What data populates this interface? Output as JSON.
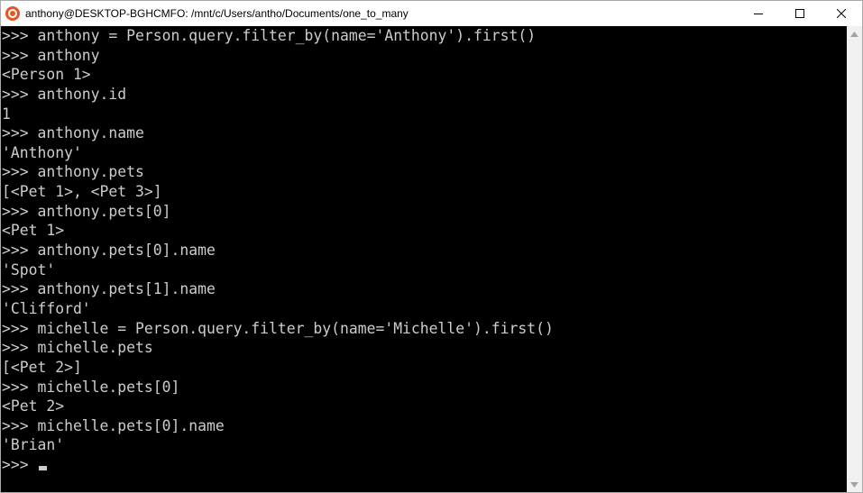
{
  "window": {
    "title": "anthony@DESKTOP-BGHCMFO: /mnt/c/Users/antho/Documents/one_to_many"
  },
  "colors": {
    "background": "#000000",
    "text": "#cccccc",
    "icon_accent": "#e95420"
  },
  "icons": {
    "app": "ubuntu-icon",
    "minimize": "minimize-icon",
    "maximize": "maximize-icon",
    "close": "close-icon",
    "scroll_up": "scroll-up-arrow-icon",
    "scroll_down": "scroll-down-arrow-icon"
  },
  "console": {
    "lines": [
      ">>> anthony = Person.query.filter_by(name='Anthony').first()",
      ">>> anthony",
      "<Person 1>",
      ">>> anthony.id",
      "1",
      ">>> anthony.name",
      "'Anthony'",
      ">>> anthony.pets",
      "[<Pet 1>, <Pet 3>]",
      ">>> anthony.pets[0]",
      "<Pet 1>",
      ">>> anthony.pets[0].name",
      "'Spot'",
      ">>> anthony.pets[1].name",
      "'Clifford'",
      ">>> michelle = Person.query.filter_by(name='Michelle').first()",
      ">>> michelle.pets",
      "[<Pet 2>]",
      ">>> michelle.pets[0]",
      "<Pet 2>",
      ">>> michelle.pets[0].name",
      "'Brian'"
    ],
    "prompt": ">>> "
  }
}
